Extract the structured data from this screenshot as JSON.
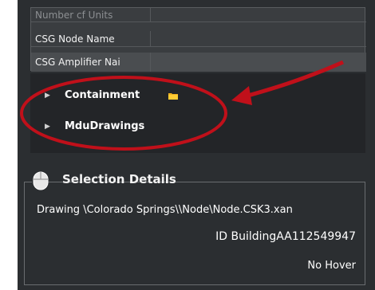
{
  "properties": {
    "rows": [
      {
        "label": "Number cf Units"
      },
      {
        "label": "CSG Node Name"
      },
      {
        "label": "CSG Amplifier Nai"
      }
    ]
  },
  "tree": {
    "items": [
      {
        "label": "Containment",
        "icon": "folder-icon"
      },
      {
        "label": "MduDrawings"
      }
    ]
  },
  "annotation": {
    "color": "#c0101a"
  },
  "selection_details": {
    "title": "Selection Details",
    "drawing": "Drawing \\Colorado Springs\\\\Node\\Node.CSK3.xan",
    "id": "ID BuildingAA112549947",
    "hover": "No Hover"
  }
}
